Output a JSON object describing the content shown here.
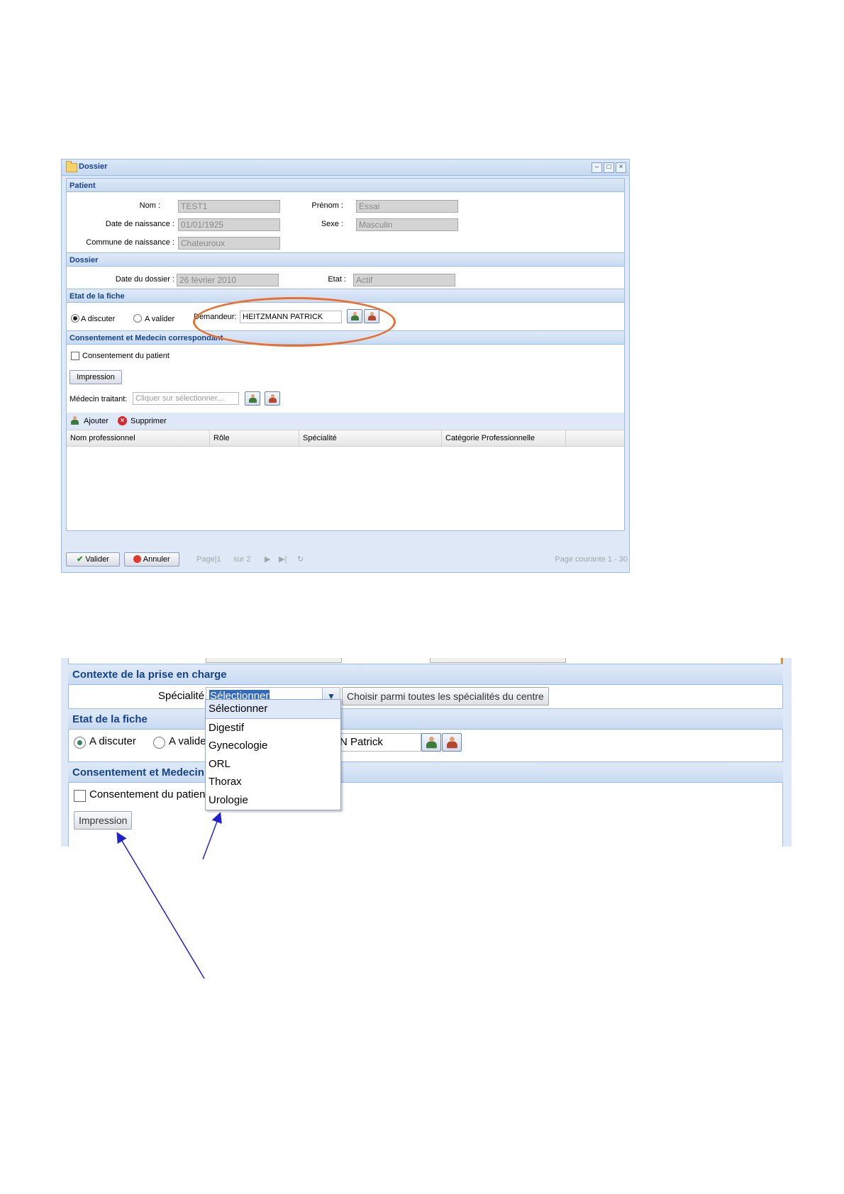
{
  "window": {
    "title": "Dossier",
    "tool_icons": [
      "minimize-icon",
      "maximize-icon",
      "close-icon"
    ],
    "tool_glyphs": [
      "–",
      "□",
      "×"
    ]
  },
  "patient": {
    "section_title": "Patient",
    "nom_label": "Nom :",
    "nom_value": "TEST1",
    "prenom_label": "Prénom :",
    "prenom_value": "Essai",
    "naissance_label": "Date de naissance :",
    "naissance_value": "01/01/1925",
    "sexe_label": "Sexe :",
    "sexe_value": "Masculin",
    "commune_label": "Commune de naissance :",
    "commune_value": "Chateuroux"
  },
  "dossier": {
    "section_title": "Dossier",
    "date_label": "Date du dossier :",
    "date_value": "26 février 2010",
    "etat_label": "Etat :",
    "etat_value": "Actif"
  },
  "etat_fiche": {
    "section_title": "Etat de la fiche",
    "radio_discuter": "A discuter",
    "radio_valider": "A valider",
    "demandeur_label": "Demandeur:",
    "demandeur_value": "HEITZMANN PATRICK"
  },
  "consentement": {
    "section_title": "Consentement et Medecin correspondant",
    "checkbox_label": "Consentement du patient",
    "impression_label": "Impression",
    "medecin_label": "Médecin traitant:",
    "medecin_placeholder": "Cliquer sur sélectionner...",
    "ajouter_label": "Ajouter",
    "supprimer_label": "Supprimer",
    "columns": [
      "Nom professionnel",
      "Rôle",
      "Spécialité",
      "Catégorie Professionnelle"
    ]
  },
  "footer": {
    "valider_label": "Valider",
    "annuler_label": "Annuler",
    "page_label": "Page",
    "page_value": "1",
    "sur_label": "sur 2",
    "page_courante": "Page courante 1 - 30"
  },
  "zoom": {
    "contexte_title": "Contexte de la prise en charge",
    "specialite_label": "Spécialité :",
    "specialite_selected": "Sélectionner",
    "choisir_button": "Choisir parmi toutes les spécialités du centre",
    "etat_title": "Etat de la fiche",
    "radio_discuter": "A discuter",
    "radio_valider_partial": "A valide",
    "demandeur_partial": "N Patrick",
    "consent_title_partial": "Consentement et Medecin",
    "checkbox_label": "Consentement du patient",
    "impression_label": "Impression",
    "options": [
      "Sélectionner",
      "Digestif",
      "Gynecologie",
      "ORL",
      "Thorax",
      "Urologie"
    ]
  },
  "colors": {
    "highlight_oval": "#ec6e2c",
    "arrows": "#2020d0",
    "header_text": "#15428b"
  }
}
